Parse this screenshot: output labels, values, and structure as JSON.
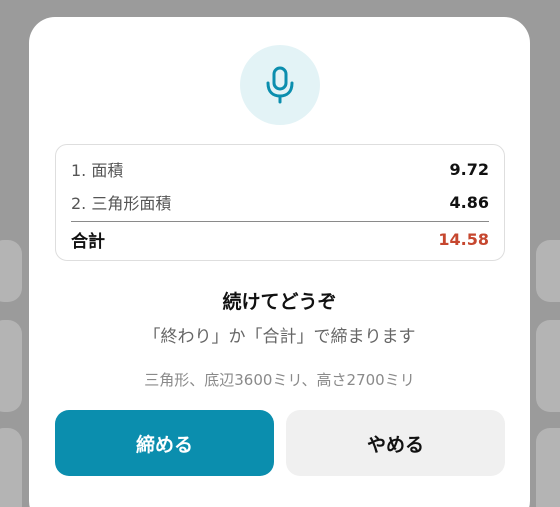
{
  "dialog": {
    "mic_icon": "microphone-icon",
    "accent_color": "#0b8eae",
    "items": [
      {
        "label": "1. 面積",
        "value": "9.72"
      },
      {
        "label": "2. 三角形面積",
        "value": "4.86"
      }
    ],
    "total": {
      "label": "合計",
      "value": "14.58",
      "color": "#c6472f"
    },
    "heading": "続けてどうぞ",
    "subtitle": "「終わり」か「合計」で締まります",
    "transcript": "三角形、底辺3600ミリ、高さ2700ミリ",
    "primary_button": "締める",
    "secondary_button": "やめる"
  }
}
